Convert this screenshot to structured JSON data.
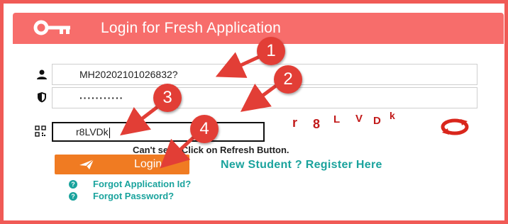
{
  "header": {
    "title": "Login for Fresh Application",
    "icon": "key-icon"
  },
  "form": {
    "application_id": {
      "value": "MH20202101026832?",
      "icon": "user-icon"
    },
    "password": {
      "value": "···········",
      "icon": "shield-icon"
    },
    "captcha_input": {
      "value": "r8LVDk",
      "icon": "qr-icon"
    },
    "captcha_image_text": "r 8 L V D k",
    "hint": "Can't see? Click on Refresh Button.",
    "login_label": "Login",
    "register_link": "New Student ? Register Here",
    "forgot_application": "Forgot Application Id?",
    "forgot_password": "Forgot Password?"
  },
  "callouts": [
    "1",
    "2",
    "3",
    "4"
  ],
  "colors": {
    "header": "#f76d6b",
    "border": "#f05a56",
    "button": "#f07b22",
    "link": "#1aa39d",
    "callout": "#e23e36"
  }
}
